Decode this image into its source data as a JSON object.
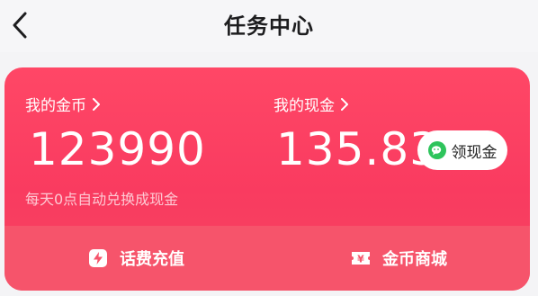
{
  "header": {
    "title": "任务中心",
    "back_icon": "chevron-left-icon"
  },
  "wallet": {
    "coins": {
      "label": "我的金币",
      "value": "123990",
      "note": "每天0点自动兑换成现金"
    },
    "cash": {
      "label": "我的现金",
      "value": "135.83",
      "withdraw_label": "领现金",
      "withdraw_icon": "wechat-icon"
    }
  },
  "actions": [
    {
      "label": "话费充值",
      "icon": "lightning-icon"
    },
    {
      "label": "金币商城",
      "icon": "yen-ticket-icon"
    }
  ],
  "colors": {
    "card_top": "#ff4766",
    "card_bottom": "#f6546b",
    "wechat_green": "#2ec45c"
  }
}
